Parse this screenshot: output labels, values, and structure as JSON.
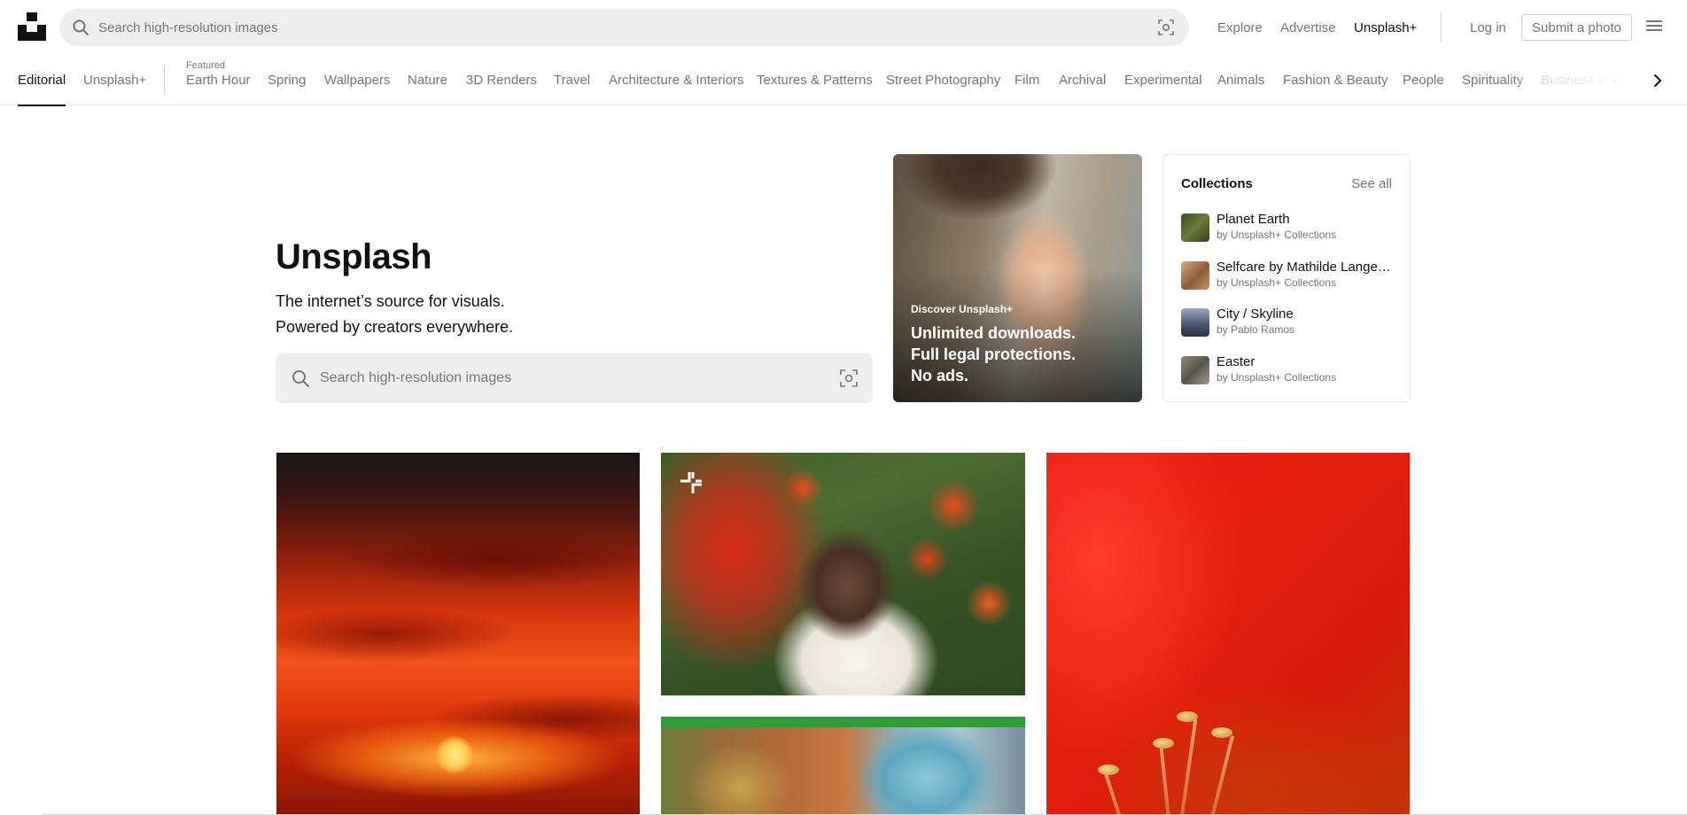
{
  "header": {
    "logo": "unsplash-logo",
    "search_placeholder": "Search high-resolution images",
    "links": [
      "Explore",
      "Advertise",
      "Unsplash+"
    ],
    "login": "Log in",
    "submit": "Submit a photo"
  },
  "nav": {
    "tabs": [
      "Editorial",
      "Unsplash+"
    ],
    "featured_label": "Featured",
    "categories": [
      "Earth Hour",
      "Spring",
      "Wallpapers",
      "Nature",
      "3D Renders",
      "Travel",
      "Architecture & Interiors",
      "Textures & Patterns",
      "Street Photography",
      "Film",
      "Archival",
      "Experimental",
      "Animals",
      "Fashion & Beauty",
      "People",
      "Spirituality",
      "Business & Work"
    ]
  },
  "hero": {
    "title": "Unsplash",
    "line1": "The internet’s source for visuals.",
    "line2": "Powered by creators everywhere.",
    "search_placeholder": "Search high-resolution images"
  },
  "promo": {
    "kicker": "Discover Unsplash+",
    "line1": "Unlimited downloads.",
    "line2": "Full legal protections.",
    "line3": "No ads."
  },
  "collections": {
    "title": "Collections",
    "see_all": "See all",
    "items": [
      {
        "name": "Planet Earth",
        "by": "by Unsplash+ Collections",
        "color": "#4d5a2a"
      },
      {
        "name": "Selfcare by Mathilde Langevin",
        "by": "by Unsplash+ Collections",
        "color": "#a86a3e"
      },
      {
        "name": "City / Skyline",
        "by": "by Pablo Ramos",
        "color": "#4e5a70"
      },
      {
        "name": "Easter",
        "by": "by Unsplash+ Collections",
        "color": "#6e6a5e"
      }
    ]
  },
  "colors": {
    "text_primary": "#111111",
    "text_secondary": "#767676",
    "search_bg": "#eeeeee",
    "border": "#d1d1d1"
  }
}
